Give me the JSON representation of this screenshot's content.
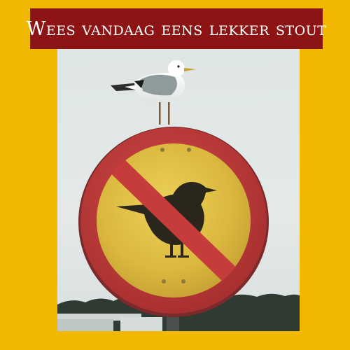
{
  "banner": {
    "text": "Wees vandaag eens lekker stout"
  },
  "photo": {
    "description_icon": "no-birds-sign-with-seagull",
    "colors": {
      "background": "#f0b800",
      "banner": "#8c1414",
      "sign_ring": "#c0393a",
      "sign_face": "#e7c64a",
      "sky": "#e2e8e7"
    }
  }
}
